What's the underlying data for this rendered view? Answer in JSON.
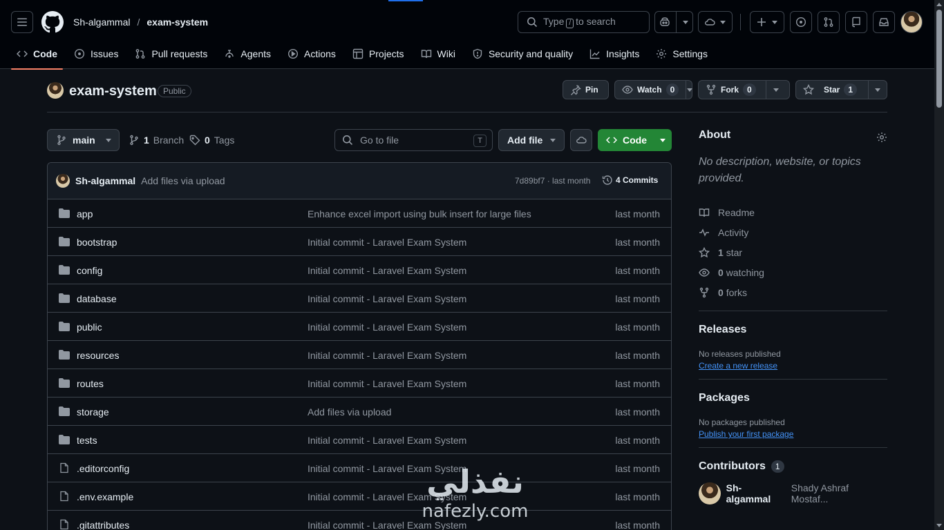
{
  "header": {
    "owner": "Sh-algammal",
    "separator": "/",
    "repo": "exam-system",
    "search_prefix": "Type",
    "search_key": "/",
    "search_suffix": "to search"
  },
  "tabs": [
    {
      "label": "Code",
      "icon": "code-icon",
      "active": true
    },
    {
      "label": "Issues",
      "icon": "issue-icon"
    },
    {
      "label": "Pull requests",
      "icon": "pull-request-icon"
    },
    {
      "label": "Agents",
      "icon": "agents-icon"
    },
    {
      "label": "Actions",
      "icon": "play-icon"
    },
    {
      "label": "Projects",
      "icon": "table-icon"
    },
    {
      "label": "Wiki",
      "icon": "book-icon"
    },
    {
      "label": "Security and quality",
      "icon": "shield-icon"
    },
    {
      "label": "Insights",
      "icon": "graph-icon"
    },
    {
      "label": "Settings",
      "icon": "gear-icon"
    }
  ],
  "repo": {
    "name": "exam-system",
    "visibility": "Public",
    "pin_label": "Pin",
    "watch_label": "Watch",
    "watch_count": "0",
    "fork_label": "Fork",
    "fork_count": "0",
    "star_label": "Star",
    "star_count": "1"
  },
  "filebar": {
    "branch": "main",
    "branch_count": "1",
    "branch_label": "Branch",
    "tag_count": "0",
    "tag_label": "Tags",
    "goto_placeholder": "Go to file",
    "goto_key": "T",
    "add_file_label": "Add file",
    "code_label": "Code"
  },
  "commit": {
    "author": "Sh-algammal",
    "message": "Add files via upload",
    "hash_time": "7d89bf7 · last month",
    "commits_label": "4 Commits"
  },
  "files": [
    {
      "name": "app",
      "type": "folder",
      "message": "Enhance excel import using bulk insert for large files",
      "date": "last month"
    },
    {
      "name": "bootstrap",
      "type": "folder",
      "message": "Initial commit - Laravel Exam System",
      "date": "last month"
    },
    {
      "name": "config",
      "type": "folder",
      "message": "Initial commit - Laravel Exam System",
      "date": "last month"
    },
    {
      "name": "database",
      "type": "folder",
      "message": "Initial commit - Laravel Exam System",
      "date": "last month"
    },
    {
      "name": "public",
      "type": "folder",
      "message": "Initial commit - Laravel Exam System",
      "date": "last month"
    },
    {
      "name": "resources",
      "type": "folder",
      "message": "Initial commit - Laravel Exam System",
      "date": "last month"
    },
    {
      "name": "routes",
      "type": "folder",
      "message": "Initial commit - Laravel Exam System",
      "date": "last month"
    },
    {
      "name": "storage",
      "type": "folder",
      "message": "Add files via upload",
      "date": "last month"
    },
    {
      "name": "tests",
      "type": "folder",
      "message": "Initial commit - Laravel Exam System",
      "date": "last month"
    },
    {
      "name": ".editorconfig",
      "type": "file",
      "message": "Initial commit - Laravel Exam System",
      "date": "last month"
    },
    {
      "name": ".env.example",
      "type": "file",
      "message": "Initial commit - Laravel Exam System",
      "date": "last month"
    },
    {
      "name": ".gitattributes",
      "type": "file",
      "message": "Initial commit - Laravel Exam System",
      "date": "last month"
    }
  ],
  "about": {
    "title": "About",
    "description": "No description, website, or topics provided.",
    "readme": "Readme",
    "activity": "Activity",
    "stars_count": "1",
    "stars_label": "star",
    "watching_count": "0",
    "watching_label": "watching",
    "forks_count": "0",
    "forks_label": "forks"
  },
  "releases": {
    "title": "Releases",
    "status": "No releases published",
    "link": "Create a new release"
  },
  "packages": {
    "title": "Packages",
    "status": "No packages published",
    "link": "Publish your first package"
  },
  "contributors": {
    "title": "Contributors",
    "count": "1",
    "login": "Sh-algammal",
    "full_name": "Shady Ashraf Mostaf..."
  },
  "watermark": {
    "arabic": "نفذلي",
    "latin": "nafezly.com"
  },
  "colors": {
    "background": "#0d1117",
    "header": "#010409",
    "accent": "#1f6feb",
    "code_button": "#238636",
    "active_tab_underline": "#f78166",
    "link": "#4493f8"
  }
}
